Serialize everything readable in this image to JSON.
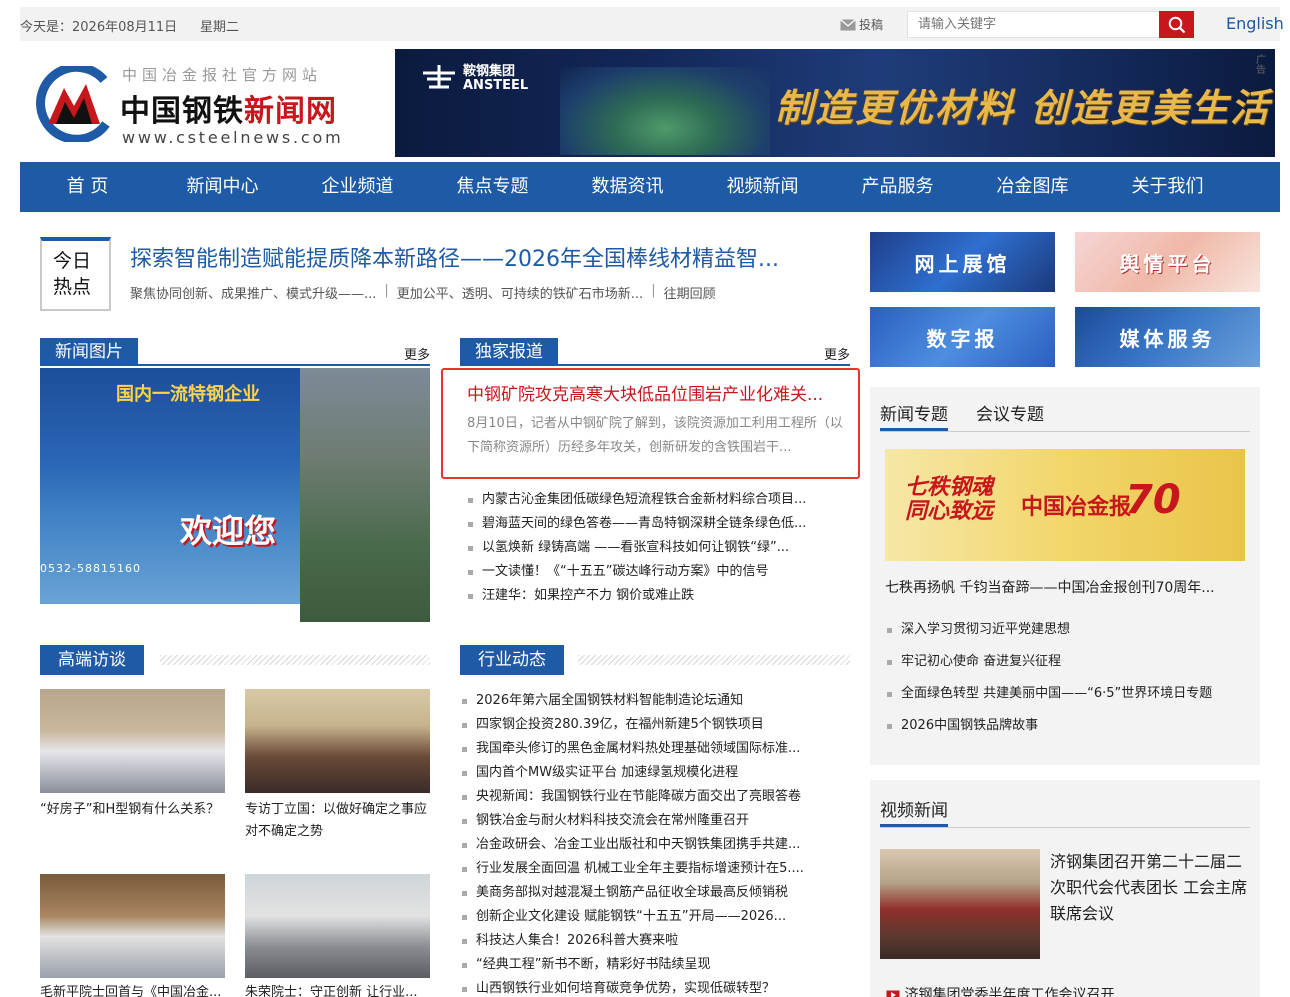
{
  "topbar": {
    "date": "今天是：2026年08月11日",
    "weekday": "星期二",
    "submit_label": "投稿",
    "search_placeholder": "请输入关键字",
    "english_label": "English"
  },
  "logo": {
    "subtitle": "中国冶金报社官方网站",
    "name_black": "中国钢铁",
    "name_red": "新闻网",
    "url": "www.csteelnews.com"
  },
  "banner": {
    "brand_cn": "鞍钢集团",
    "brand_en": "ANSTEEL",
    "slogan": "制造更优材料 创造更美生活",
    "ad_label": "广告"
  },
  "nav": [
    {
      "label": "首 页"
    },
    {
      "label": "新闻中心"
    },
    {
      "label": "企业频道"
    },
    {
      "label": "焦点专题"
    },
    {
      "label": "数据资讯"
    },
    {
      "label": "视频新闻"
    },
    {
      "label": "产品服务"
    },
    {
      "label": "冶金图库"
    },
    {
      "label": "关于我们"
    }
  ],
  "hot": {
    "badge_line1": "今日",
    "badge_line2": "热点",
    "headline": "探索智能制造赋能提质降本新路径——2026年全国棒线材精益智...",
    "subheads": [
      "聚焦协同创新、成果推广、模式升级——...",
      "更加公平、透明、可持续的铁矿石市场新...",
      "往期回顾"
    ]
  },
  "news_photo": {
    "title": "新闻图片",
    "more": "更多",
    "img_title": "国内一流特钢企业",
    "img_welcome": "欢迎您",
    "img_phone": "0532-58815160"
  },
  "exclusive": {
    "title": "独家报道",
    "more": "更多",
    "lead_title": "中钢矿院攻克高寒大块低品位围岩产业化难关...",
    "lead_summary": "8月10日，记者从中钢矿院了解到，该院资源加工利用工程所（以下简称资源所）历经多年攻关，创新研发的含铁围岩干...",
    "items": [
      "内蒙古沁金集团低碳绿色短流程铁合金新材料综合项目...",
      "碧海蓝天间的绿色答卷——青岛特钢深耕全链条绿色低...",
      "以氢焕新 绿铸高端 ——看张宣科技如何让钢铁“绿”...",
      "一文读懂！《“十五五”碳达峰行动方案》中的信号",
      "汪建华：如果控产不力 钢价或难止跌"
    ]
  },
  "interviews": {
    "title": "高端访谈",
    "items": [
      {
        "caption": "“好房子”和H型钢有什么关系？"
      },
      {
        "caption": "专访丁立国：以做好确定之事应对不确定之势"
      },
      {
        "caption": "毛新平院士回首与《中国冶金..."
      },
      {
        "caption": "朱荣院士：守正创新 让行业..."
      }
    ]
  },
  "industry": {
    "title": "行业动态",
    "items": [
      "2026年第六届全国钢铁材料智能制造论坛通知",
      "四家钢企投资280.39亿，在福州新建5个钢铁项目",
      "我国牵头修订的黑色金属材料热处理基础领域国际标准...",
      "国内首个MW级实证平台 加速绿氢规模化进程",
      "央视新闻：我国钢铁行业在节能降碳方面交出了亮眼答卷",
      "钢铁冶金与耐火材料科技交流会在常州隆重召开",
      "冶金政研会、冶金工业出版社和中天钢铁集团携手共建...",
      "行业发展全面回温 机械工业全年主要指标增速预计在5....",
      "美商务部拟对越混凝土钢筋产品征收全球最高反倾销税",
      "创新企业文化建设 赋能钢铁“十五五”开局——2026...",
      "科技达人集合！2026科普大赛来啦",
      "“经典工程”新书不断，精彩好书陆续呈现",
      "山西钢铁行业如何培育碳竞争优势，实现低碳转型？"
    ]
  },
  "tiles": [
    {
      "label": "网上展馆"
    },
    {
      "label": "舆情平台"
    },
    {
      "label": "数字报"
    },
    {
      "label": "媒体服务"
    }
  ],
  "topics": {
    "tab_news": "新闻专题",
    "tab_meeting": "会议专题",
    "img_text1": "七秩钢魂 同心致远",
    "img_text2": "中国冶金报",
    "img_text3": "70",
    "caption": "七秩再扬帆 千钧当奋蹄——中国冶金报创刊70周年...",
    "items": [
      "深入学习贯彻习近平党建思想",
      "牢记初心使命 奋进复兴征程",
      "全面绿色转型 共建美丽中国——“6·5”世界环境日专题",
      "2026中国钢铁品牌故事"
    ]
  },
  "video": {
    "title": "视频新闻",
    "lead_title": "济钢集团召开第二十二届二次职代会代表团长 工会主席联席会议",
    "next": "济钢集团党委半年度工作会议召开"
  },
  "colors": {
    "brand_blue": "#1e5aa5",
    "brand_red": "#c8161d"
  }
}
